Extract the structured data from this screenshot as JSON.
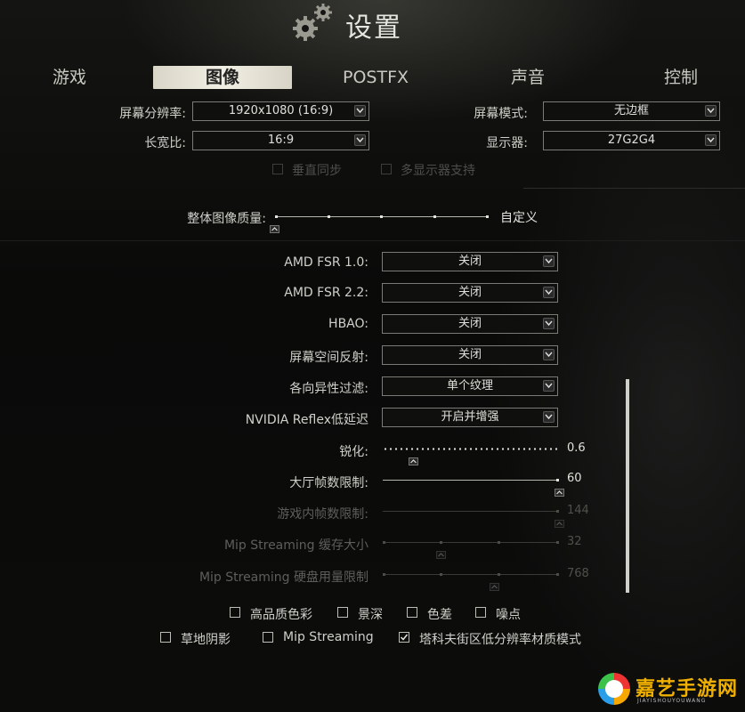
{
  "header": {
    "title": "设置",
    "icon": "gears-icon"
  },
  "tabs": [
    {
      "label": "游戏"
    },
    {
      "label": "图像",
      "active": true
    },
    {
      "label": "POSTFX"
    },
    {
      "label": "声音"
    },
    {
      "label": "控制"
    }
  ],
  "display": {
    "resolution_label": "屏幕分辨率:",
    "resolution_value": "1920x1080 (16:9)",
    "screen_mode_label": "屏幕模式:",
    "screen_mode_value": "无边框",
    "aspect_label": "长宽比:",
    "aspect_value": "16:9",
    "monitor_label": "显示器:",
    "monitor_value": "27G2G4",
    "vsync_label": "垂直同步",
    "multimonitor_label": "多显示器支持"
  },
  "quality": {
    "label": "整体图像质量:",
    "value": "自定义",
    "level": 0
  },
  "dropdowns": [
    {
      "label": "AMD FSR 1.0:",
      "value": "关闭"
    },
    {
      "label": "AMD FSR 2.2:",
      "value": "关闭"
    },
    {
      "label": "HBAO:",
      "value": "关闭"
    },
    {
      "label": "屏幕空间反射:",
      "value": "关闭"
    },
    {
      "label": "各向异性过滤:",
      "value": "单个纹理"
    },
    {
      "label": "NVIDIA Reflex低延迟",
      "value": "开启并增强"
    }
  ],
  "sliders": {
    "sharpen": {
      "label": "锐化:",
      "value": "0.6",
      "fraction": 0.17
    },
    "lobby_fps": {
      "label": "大厅帧数限制:",
      "value": "60",
      "fraction": 1.0
    },
    "game_fps": {
      "label": "游戏内帧数限制:",
      "value": "144",
      "fraction": 1.0
    },
    "mip_cache": {
      "label": "Mip Streaming 缓存大小",
      "value": "32",
      "fraction": 0.33
    },
    "mip_disk": {
      "label": "Mip Streaming 硬盘用量限制",
      "value": "768",
      "fraction": 0.63
    }
  },
  "checkboxes": {
    "hq_color": {
      "label": "高品质色彩",
      "checked": false
    },
    "dof": {
      "label": "景深",
      "checked": false
    },
    "chromatic": {
      "label": "色差",
      "checked": false
    },
    "noise": {
      "label": "噪点",
      "checked": false
    },
    "grass_shadow": {
      "label": "草地阴影",
      "checked": false
    },
    "mip_streaming": {
      "label": "Mip Streaming",
      "checked": false
    },
    "tarkov_lowres": {
      "label": "塔科夫街区低分辨率材质模式",
      "checked": true
    }
  },
  "watermark": {
    "text": "嘉艺手游网",
    "sub": "JIAYISHOUYOUWANG"
  },
  "colors": {
    "accent": "#e8e6da",
    "text": "#d0d0ca",
    "dim": "#5e5e5a"
  }
}
